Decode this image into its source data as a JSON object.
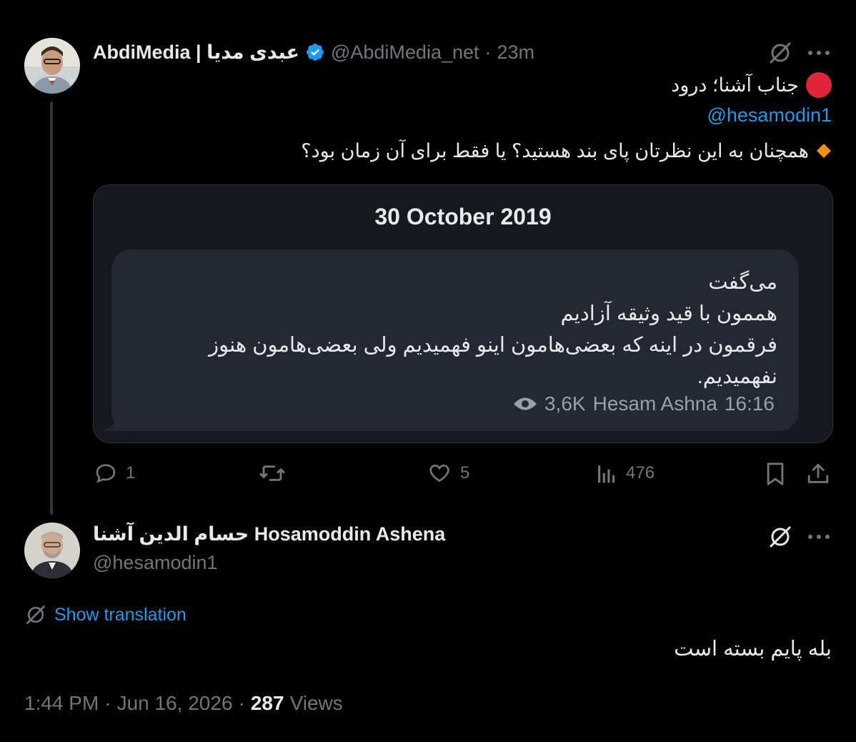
{
  "tweet": {
    "author_name": "AbdiMedia | عبدی مدیا",
    "handle": "@AbdiMedia_net",
    "time_ago": "23m",
    "dot": "·",
    "verified_icon": "verified-badge-icon",
    "line1": "جناب آشنا؛ درود",
    "mention": "@hesamodin1",
    "line3": "همچنان به این نظرتان پای بند هستید؟ یا فقط برای آن زمان بود؟",
    "red_circle_color": "#e0243a",
    "diamond_color": "#f4900c",
    "card": {
      "date": "30 October 2019",
      "message_lines": [
        "می‌گفت",
        "هممون با قید وثیقه آزادیم",
        "فرقمون در اینه که بعضی‌هامون اینو فهمیدیم ولی بعضی‌هامون هنوز",
        "نفهمیدیم."
      ],
      "views": "3,6K",
      "sender": "Hesam Ashna",
      "time": "16:16"
    },
    "actions": {
      "replies": "1",
      "reposts": "",
      "likes": "5",
      "views": "476"
    }
  },
  "reply": {
    "author_name": "حسام الدین آشنا Hosamoddin Ashena",
    "handle": "@hesamodin1",
    "show_translation": "Show translation",
    "text": "بله پایم بسته است",
    "time": "1:44 PM",
    "date": "Jun 16, 2026",
    "views_count": "287",
    "views_label": "Views",
    "dot": "·"
  },
  "colors": {
    "background": "#000000",
    "text": "#e7e9ea",
    "muted": "#71767b",
    "link": "#1d9bf0"
  }
}
